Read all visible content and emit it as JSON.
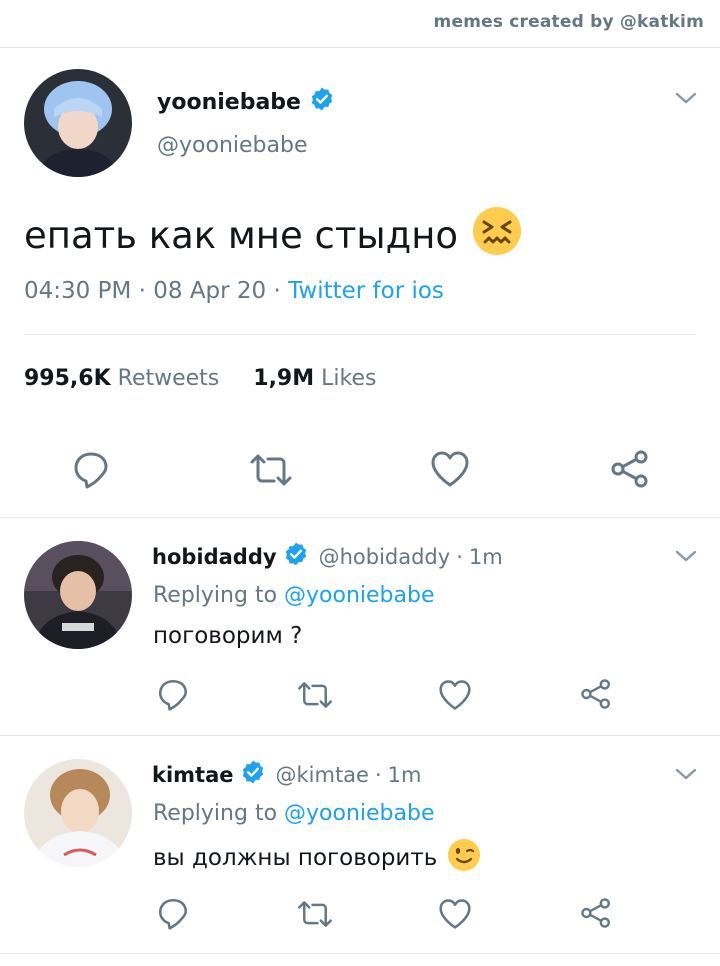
{
  "credit": "memes created by @katkim",
  "main_tweet": {
    "name": "yooniebabe",
    "handle": "@yooniebabe",
    "text": "епать как мне стыдно",
    "emoji": "confounded-face",
    "time": "04:30 PM",
    "date": "08 Apr 20",
    "source": "Twitter for ios",
    "retweets": "995,6K",
    "retweets_label": "Retweets",
    "likes": "1,9M",
    "likes_label": "Likes"
  },
  "replies": [
    {
      "name": "hobidaddy",
      "handle": "@hobidaddy",
      "time": "1m",
      "replying_label": "Replying to",
      "replying_to": "@yooniebabe",
      "text": "поговорим ?"
    },
    {
      "name": "kimtae",
      "handle": "@kimtae",
      "time": "1m",
      "replying_label": "Replying to",
      "replying_to": "@yooniebabe",
      "text": "вы должны поговорить",
      "emoji": "winking-face"
    }
  ],
  "colors": {
    "accent": "#1da1f2",
    "muted": "#657786",
    "divider": "#e1e8ed",
    "text": "#14171a",
    "emoji": "#ffcc4d"
  }
}
